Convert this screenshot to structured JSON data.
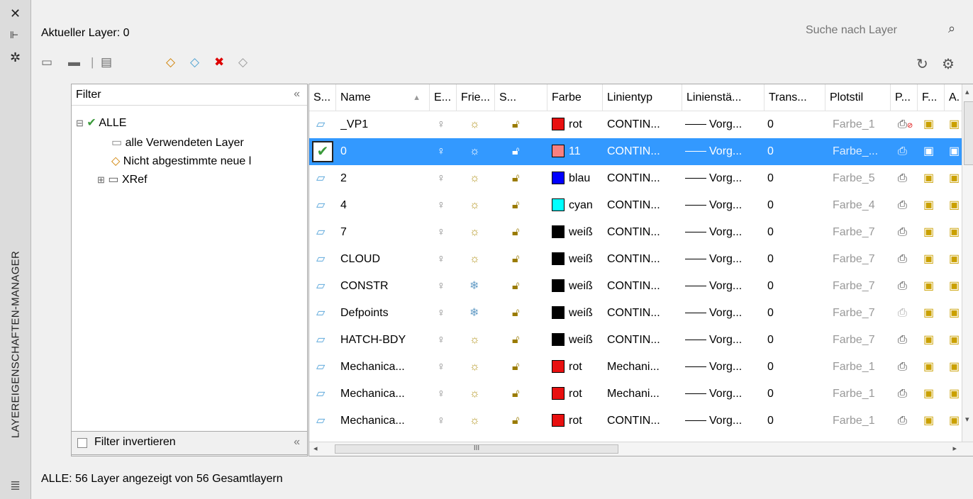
{
  "palette": {
    "title": "LAYEREIGENSCHAFTEN-MANAGER",
    "buttons": [
      "close-icon",
      "autohide-icon",
      "properties-icon"
    ]
  },
  "header": {
    "current_layer": "Aktueller Layer: 0",
    "search_placeholder": "Suche nach Layer"
  },
  "filter": {
    "title": "Filter",
    "tree": [
      {
        "label": "ALLE"
      },
      {
        "label": "alle Verwendeten Layer"
      },
      {
        "label": "Nicht abgestimmte neue l"
      },
      {
        "label": "XRef"
      }
    ],
    "invert_label": "Filter invertieren"
  },
  "columns": [
    "S...",
    "Name",
    "E...",
    "Frie...",
    "S...",
    "Farbe",
    "Linientyp",
    "Linienstä...",
    "Trans...",
    "Plotstil",
    "P...",
    "F...",
    "A."
  ],
  "rows": [
    {
      "name": "_VP1",
      "frozen": "sun",
      "color": "#e81010",
      "color_name": "rot",
      "linetype": "CONTIN...",
      "lineweight": "Vorg...",
      "transparency": "0",
      "plotstyle": "Farbe_1",
      "print": "no-plot",
      "selected": false
    },
    {
      "name": "0",
      "frozen": "sun",
      "color": "#f88080",
      "color_name": "11",
      "linetype": "CONTIN...",
      "lineweight": "Vorg...",
      "transparency": "0",
      "plotstyle": "Farbe_...",
      "print": "plot",
      "selected": true
    },
    {
      "name": "2",
      "frozen": "sun",
      "color": "#0000ff",
      "color_name": "blau",
      "linetype": "CONTIN...",
      "lineweight": "Vorg...",
      "transparency": "0",
      "plotstyle": "Farbe_5",
      "print": "plot",
      "selected": false
    },
    {
      "name": "4",
      "frozen": "sun",
      "color": "#00ffff",
      "color_name": "cyan",
      "linetype": "CONTIN...",
      "lineweight": "Vorg...",
      "transparency": "0",
      "plotstyle": "Farbe_4",
      "print": "plot",
      "selected": false
    },
    {
      "name": "7",
      "frozen": "sun",
      "color": "#000000",
      "color_name": "weiß",
      "linetype": "CONTIN...",
      "lineweight": "Vorg...",
      "transparency": "0",
      "plotstyle": "Farbe_7",
      "print": "plot",
      "selected": false
    },
    {
      "name": "CLOUD",
      "frozen": "sun",
      "color": "#000000",
      "color_name": "weiß",
      "linetype": "CONTIN...",
      "lineweight": "Vorg...",
      "transparency": "0",
      "plotstyle": "Farbe_7",
      "print": "plot",
      "selected": false
    },
    {
      "name": "CONSTR",
      "frozen": "snowflake",
      "color": "#000000",
      "color_name": "weiß",
      "linetype": "CONTIN...",
      "lineweight": "Vorg...",
      "transparency": "0",
      "plotstyle": "Farbe_7",
      "print": "plot",
      "selected": false
    },
    {
      "name": "Defpoints",
      "frozen": "snowflake",
      "color": "#000000",
      "color_name": "weiß",
      "linetype": "CONTIN...",
      "lineweight": "Vorg...",
      "transparency": "0",
      "plotstyle": "Farbe_7",
      "print": "no-plot-gray",
      "selected": false
    },
    {
      "name": "HATCH-BDY",
      "frozen": "sun",
      "color": "#000000",
      "color_name": "weiß",
      "linetype": "CONTIN...",
      "lineweight": "Vorg...",
      "transparency": "0",
      "plotstyle": "Farbe_7",
      "print": "plot",
      "selected": false
    },
    {
      "name": "Mechanica...",
      "frozen": "sun",
      "color": "#e81010",
      "color_name": "rot",
      "linetype": "Mechani...",
      "lineweight": "Vorg...",
      "transparency": "0",
      "plotstyle": "Farbe_1",
      "print": "plot",
      "selected": false
    },
    {
      "name": "Mechanica...",
      "frozen": "sun",
      "color": "#e81010",
      "color_name": "rot",
      "linetype": "Mechani...",
      "lineweight": "Vorg...",
      "transparency": "0",
      "plotstyle": "Farbe_1",
      "print": "plot",
      "selected": false
    },
    {
      "name": "Mechanica...",
      "frozen": "sun",
      "color": "#e81010",
      "color_name": "rot",
      "linetype": "CONTIN...",
      "lineweight": "Vorg...",
      "transparency": "0",
      "plotstyle": "Farbe_1",
      "print": "plot",
      "selected": false
    }
  ],
  "status": "ALLE: 56 Layer angezeigt von 56 Gesamtlayern"
}
